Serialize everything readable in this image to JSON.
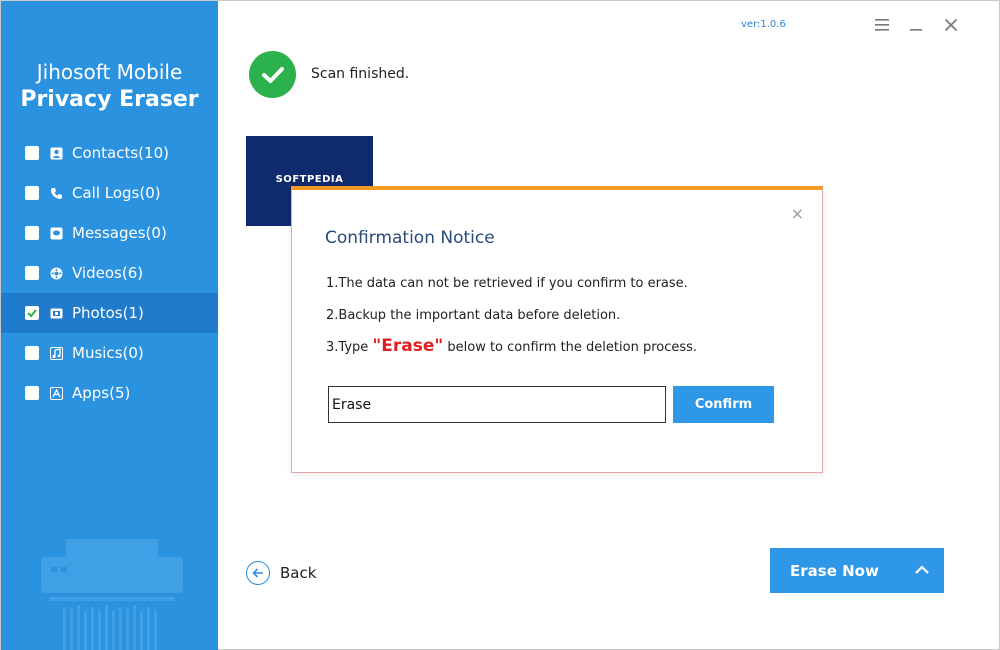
{
  "app": {
    "title_line1": "Jihosoft Mobile",
    "title_line2": "Privacy Eraser",
    "version": "ver:1.0.6"
  },
  "sidebar": {
    "items": [
      {
        "label": "Contacts(10)",
        "icon": "contacts-icon",
        "checked": false
      },
      {
        "label": "Call Logs(0)",
        "icon": "phone-icon",
        "checked": false
      },
      {
        "label": "Messages(0)",
        "icon": "message-icon",
        "checked": false
      },
      {
        "label": "Videos(6)",
        "icon": "video-icon",
        "checked": false
      },
      {
        "label": "Photos(1)",
        "icon": "photo-icon",
        "checked": true
      },
      {
        "label": "Musics(0)",
        "icon": "music-icon",
        "checked": false
      },
      {
        "label": "Apps(5)",
        "icon": "apps-icon",
        "checked": false
      }
    ]
  },
  "status": {
    "text": "Scan finished."
  },
  "thumbnail": {
    "text": "SOFTPEDIA"
  },
  "dialog": {
    "title": "Confirmation Notice",
    "line1": "1.The data can not be retrieved if you confirm to erase.",
    "line2": "2.Backup the important data before deletion.",
    "line3_prefix": "3.Type ",
    "line3_keyword": "\"Erase\"",
    "line3_suffix": " below to confirm the deletion process.",
    "input_value": "Erase",
    "confirm_label": "Confirm",
    "close_symbol": "×"
  },
  "footer": {
    "back_label": "Back",
    "erase_now_label": "Erase Now"
  },
  "colors": {
    "sidebar": "#2b92e0",
    "sidebar_active": "#1f7ccd",
    "accent": "#2e97e8",
    "success": "#2bb24c",
    "dialog_top": "#f29b22",
    "keyword": "#e02020"
  }
}
